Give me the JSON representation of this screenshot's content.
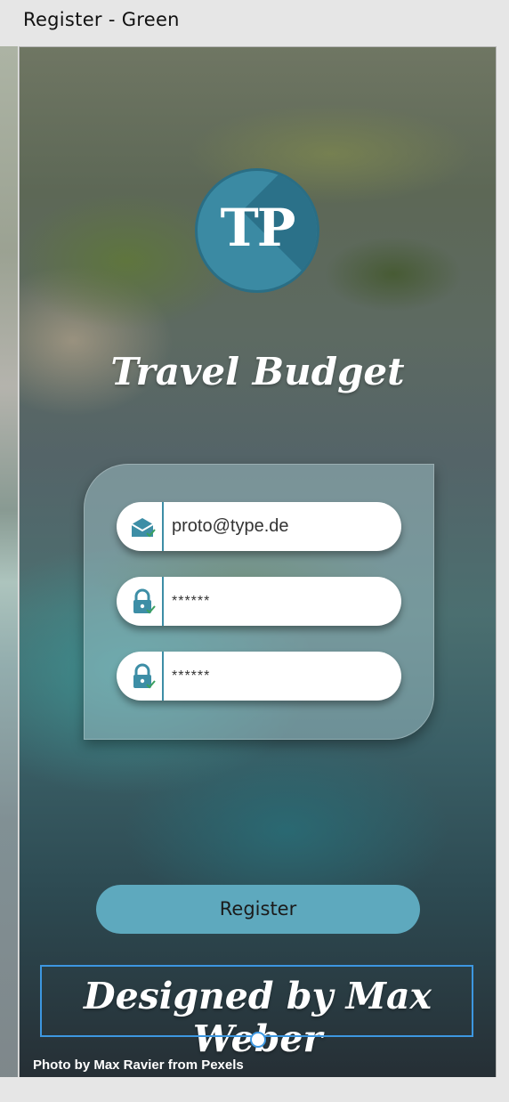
{
  "window": {
    "title": "Register - Green"
  },
  "app": {
    "logo_text": "TP",
    "title": "Travel Budget"
  },
  "form": {
    "email": {
      "value": "proto@type.de",
      "icon": "mail-check-icon"
    },
    "password": {
      "value": "******",
      "icon": "lock-check-icon"
    },
    "password_confirm": {
      "value": "******",
      "icon": "lock-check-icon"
    }
  },
  "actions": {
    "register_label": "Register"
  },
  "footer": {
    "designed_by": "Designed by Max Weber",
    "photo_credit": "Photo by Max Ravier from Pexels"
  },
  "colors": {
    "accent": "#3d8ea6",
    "button": "#5ea9be",
    "selection": "#3d97e0"
  }
}
